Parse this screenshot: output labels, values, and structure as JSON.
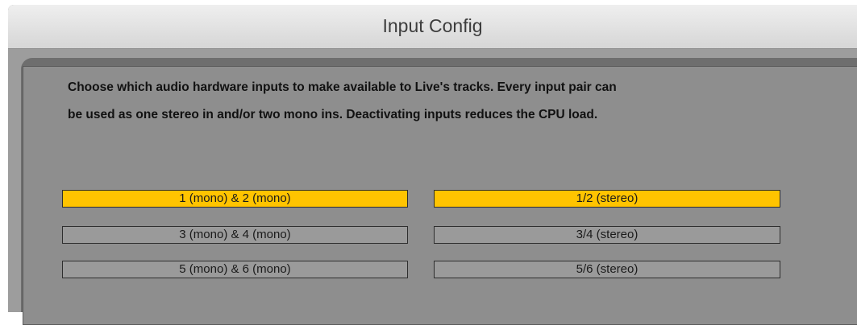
{
  "window": {
    "title": "Input Config"
  },
  "description": {
    "line1": "Choose which audio hardware inputs to make available to Live's tracks. Every input pair can",
    "line2": "be used as one stereo in and/or two mono ins.  Deactivating inputs reduces the CPU load."
  },
  "inputs": {
    "mono": [
      {
        "label": "1 (mono) & 2 (mono)",
        "active": true
      },
      {
        "label": "3 (mono) & 4 (mono)",
        "active": false
      },
      {
        "label": "5 (mono) & 6 (mono)",
        "active": false
      }
    ],
    "stereo": [
      {
        "label": "1/2 (stereo)",
        "active": true
      },
      {
        "label": "3/4 (stereo)",
        "active": false
      },
      {
        "label": "5/6 (stereo)",
        "active": false
      }
    ]
  },
  "colors": {
    "active": "#ffc400",
    "inactive": "#9a9a9a",
    "panel": "#8e8e8e"
  }
}
